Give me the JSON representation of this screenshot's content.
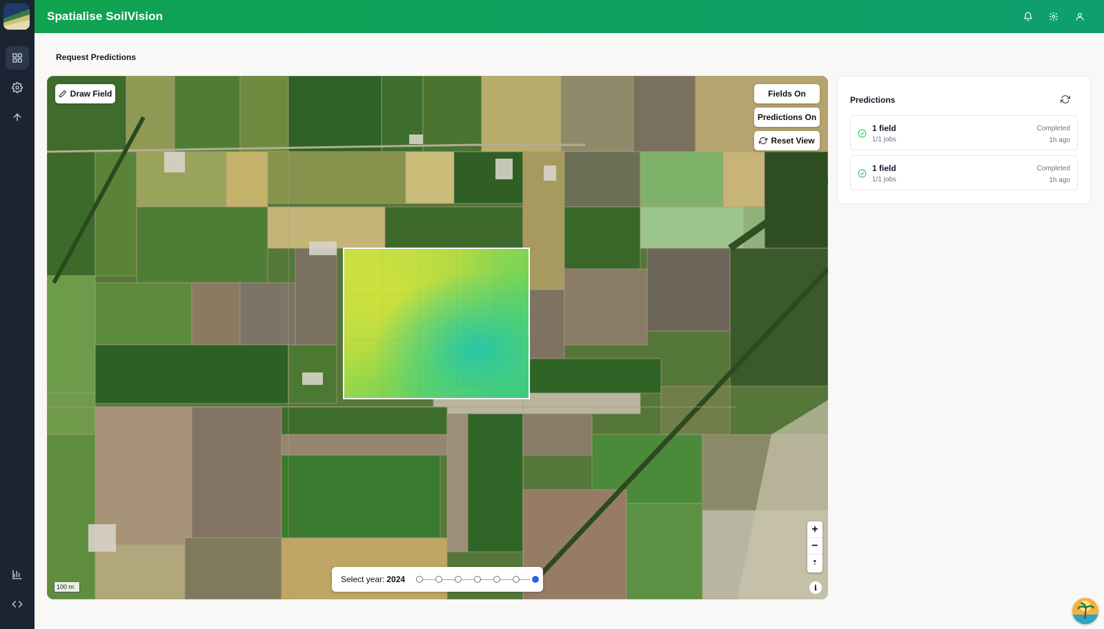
{
  "app": {
    "title": "Spatialise SoilVision"
  },
  "sidebar": {
    "items": [
      {
        "icon": "dashboard-grid-icon",
        "active": true
      },
      {
        "icon": "gear-icon",
        "active": false
      },
      {
        "icon": "arrow-up-icon",
        "active": false
      },
      {
        "icon": "bar-chart-icon",
        "active": false
      },
      {
        "icon": "code-icon",
        "active": false
      }
    ]
  },
  "header": {
    "icons": [
      "bell-icon",
      "gear-icon",
      "user-icon"
    ]
  },
  "page": {
    "title": "Request Predictions"
  },
  "map": {
    "draw_field_label": "Draw Field",
    "fields_toggle_label": "Fields On",
    "predictions_toggle_label": "Predictions On",
    "reset_view_label": "Reset View",
    "zoom_in": "+",
    "zoom_out": "−",
    "compass": "⇡",
    "info": "i",
    "scale_label": "100 m",
    "year_selector": {
      "label": "Select year:",
      "selected_year": "2024",
      "steps": 7,
      "selected_index": 6
    }
  },
  "predictions": {
    "title": "Predictions",
    "items": [
      {
        "name": "1 field",
        "jobs": "1/1 jobs",
        "status": "Completed",
        "time": "1h ago"
      },
      {
        "name": "1 field",
        "jobs": "1/1 jobs",
        "status": "Completed",
        "time": "1h ago"
      }
    ]
  },
  "colors": {
    "header": "#10a350",
    "rail": "#1b2433",
    "selected_year_dot": "#2563eb",
    "check": "#22c55e"
  }
}
